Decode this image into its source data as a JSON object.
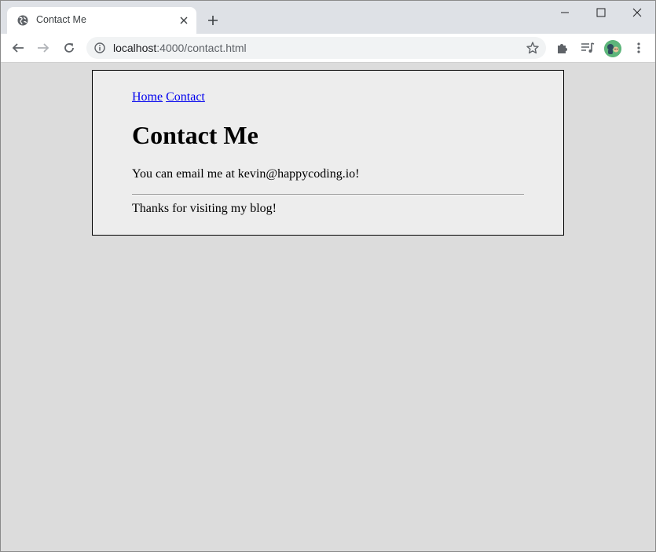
{
  "browser": {
    "tab_title": "Contact Me",
    "new_tab_label": "+",
    "url_host": "localhost",
    "url_rest": ":4000/contact.html",
    "icons": {
      "favicon": "globe-icon",
      "close_tab": "close-icon",
      "new_tab": "plus-icon",
      "minimize": "minimize-icon",
      "maximize": "maximize-icon",
      "close_window": "close-icon",
      "back": "arrow-left-icon",
      "forward": "arrow-right-icon",
      "reload": "reload-icon",
      "site_info": "info-icon",
      "bookmark": "star-icon",
      "extensions": "puzzle-icon",
      "reading_list": "reading-list-icon",
      "profile": "avatar",
      "menu": "kebab-menu-icon"
    }
  },
  "page": {
    "nav": {
      "home_link": "Home",
      "contact_link": "Contact"
    },
    "title": "Contact Me",
    "body_text": "You can email me at kevin@happycoding.io!",
    "footer_text": "Thanks for visiting my blog!"
  }
}
